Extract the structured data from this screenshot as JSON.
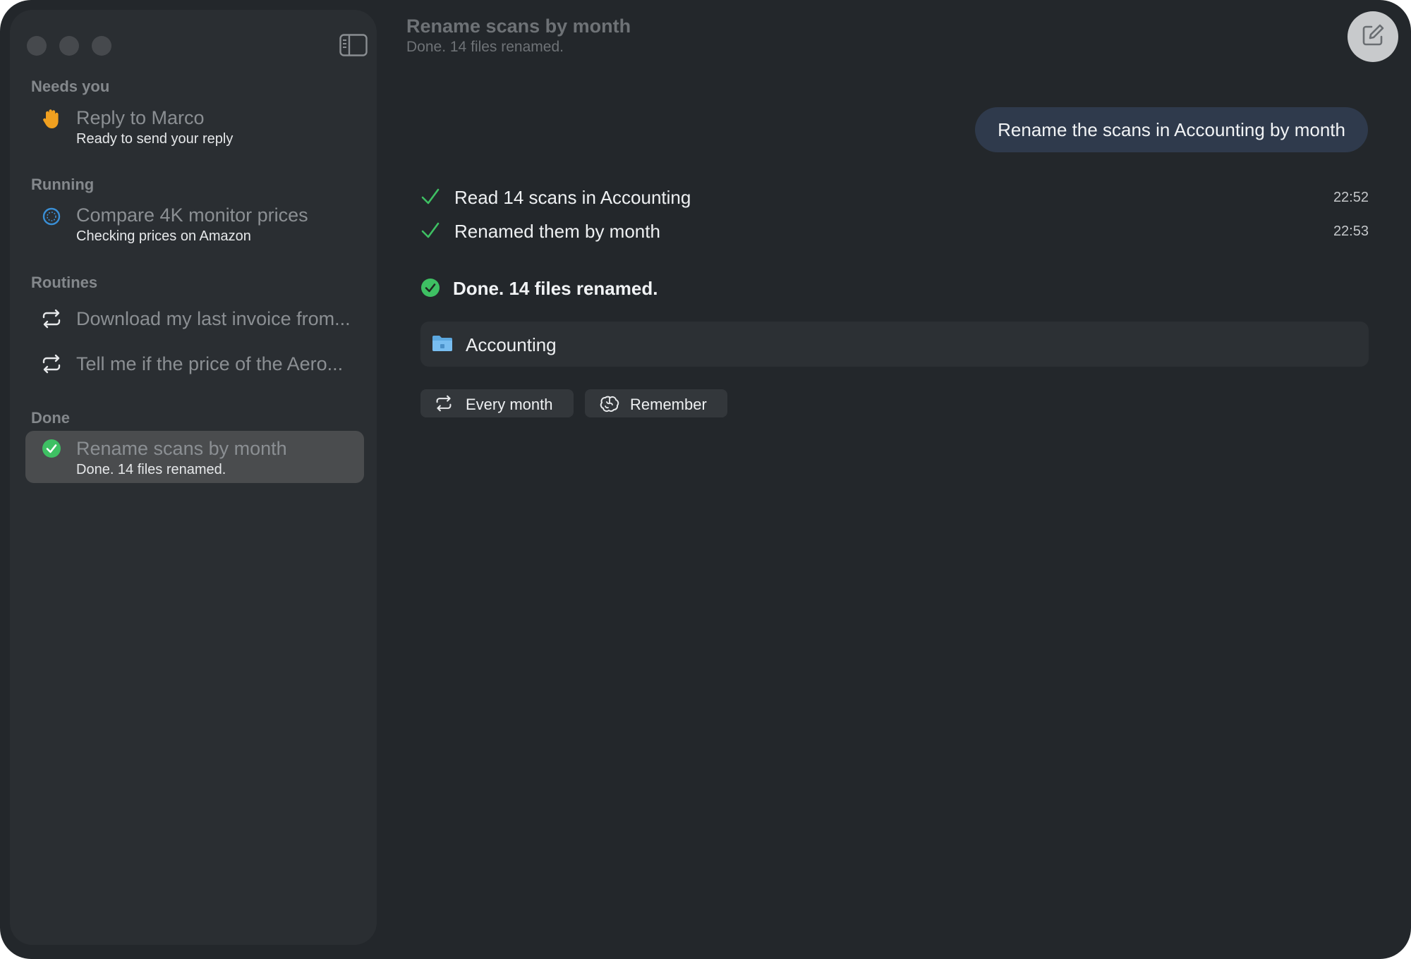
{
  "sidebar": {
    "sections": {
      "needs_you": "Needs you",
      "running": "Running",
      "routines": "Routines",
      "done": "Done"
    },
    "needs_you_task": {
      "title": "Reply to Marco",
      "subtitle": "Ready to send your reply",
      "icon": "raised-hand-icon"
    },
    "running_task": {
      "title": "Compare 4K monitor prices",
      "subtitle": "Checking prices on Amazon",
      "icon": "spinner-icon"
    },
    "routines": [
      {
        "title": "Download my last invoice from...",
        "icon": "repeat-icon"
      },
      {
        "title": "Tell me if the price of the Aero...",
        "icon": "repeat-icon"
      }
    ],
    "done_task": {
      "title": "Rename scans by month",
      "subtitle": "Done. 14 files renamed.",
      "icon": "check-circle-icon"
    }
  },
  "header": {
    "title": "Rename scans by month",
    "subtitle": "Done. 14 files renamed."
  },
  "conversation": {
    "user_message": "Rename the scans in Accounting by month",
    "steps": [
      {
        "text": "Read 14 scans in Accounting",
        "time": "22:52"
      },
      {
        "text": "Renamed them by month",
        "time": "22:53"
      }
    ],
    "result": "Done. 14 files renamed.",
    "folder": {
      "label": "Accounting",
      "icon": "folder-icon"
    },
    "actions": [
      {
        "label": "Every month",
        "icon": "repeat-icon"
      },
      {
        "label": "Remember",
        "icon": "brain-icon"
      }
    ]
  },
  "colors": {
    "window_bg": "#23272b",
    "sidebar_bg": "#2a2e32",
    "accent_green": "#3ec063",
    "accent_blue": "#3a8fd6",
    "hand_orange": "#f0a020",
    "user_bubble": "#2f3a4c"
  }
}
